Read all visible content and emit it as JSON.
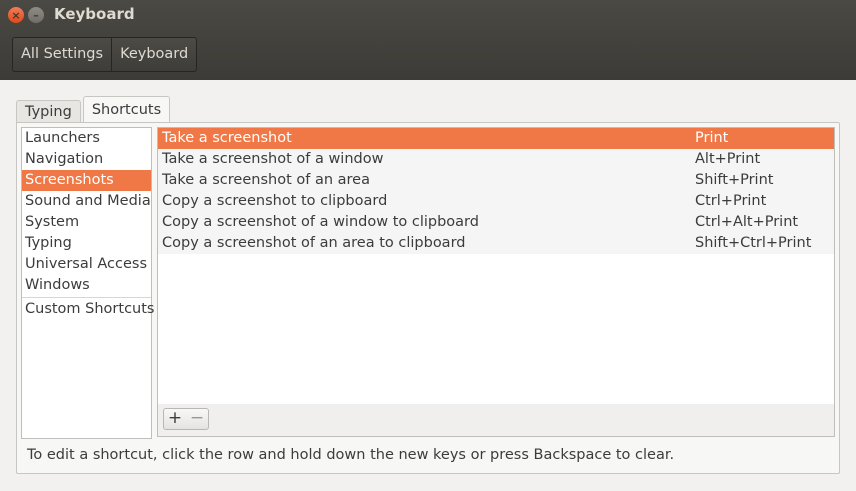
{
  "window": {
    "title": "Keyboard",
    "close_glyph": "×",
    "minimize_glyph": "–"
  },
  "breadcrumb": [
    "All Settings",
    "Keyboard"
  ],
  "tabs": [
    {
      "label": "Typing"
    },
    {
      "label": "Shortcuts",
      "active": true
    }
  ],
  "sidebar": {
    "items": [
      {
        "label": "Launchers"
      },
      {
        "label": "Navigation"
      },
      {
        "label": "Screenshots",
        "selected": true
      },
      {
        "label": "Sound and Media"
      },
      {
        "label": "System"
      },
      {
        "label": "Typing"
      },
      {
        "label": "Universal Access"
      },
      {
        "label": "Windows"
      }
    ],
    "custom_label": "Custom Shortcuts"
  },
  "shortcuts": [
    {
      "description": "Take a screenshot",
      "keys": "Print",
      "selected": true
    },
    {
      "description": "Take a screenshot of a window",
      "keys": "Alt+Print"
    },
    {
      "description": "Take a screenshot of an area",
      "keys": "Shift+Print"
    },
    {
      "description": "Copy a screenshot to clipboard",
      "keys": "Ctrl+Print"
    },
    {
      "description": "Copy a screenshot of a window to clipboard",
      "keys": "Ctrl+Alt+Print"
    },
    {
      "description": "Copy a screenshot of an area to clipboard",
      "keys": "Shift+Ctrl+Print"
    }
  ],
  "toolbar": {
    "add_glyph": "+",
    "remove_glyph": "−"
  },
  "hint": "To edit a shortcut, click the row and hold down the new keys or press Backspace to clear.",
  "colors": {
    "accent": "#f07746",
    "titlebar": "#3c3b37",
    "background": "#f2f1f0"
  }
}
